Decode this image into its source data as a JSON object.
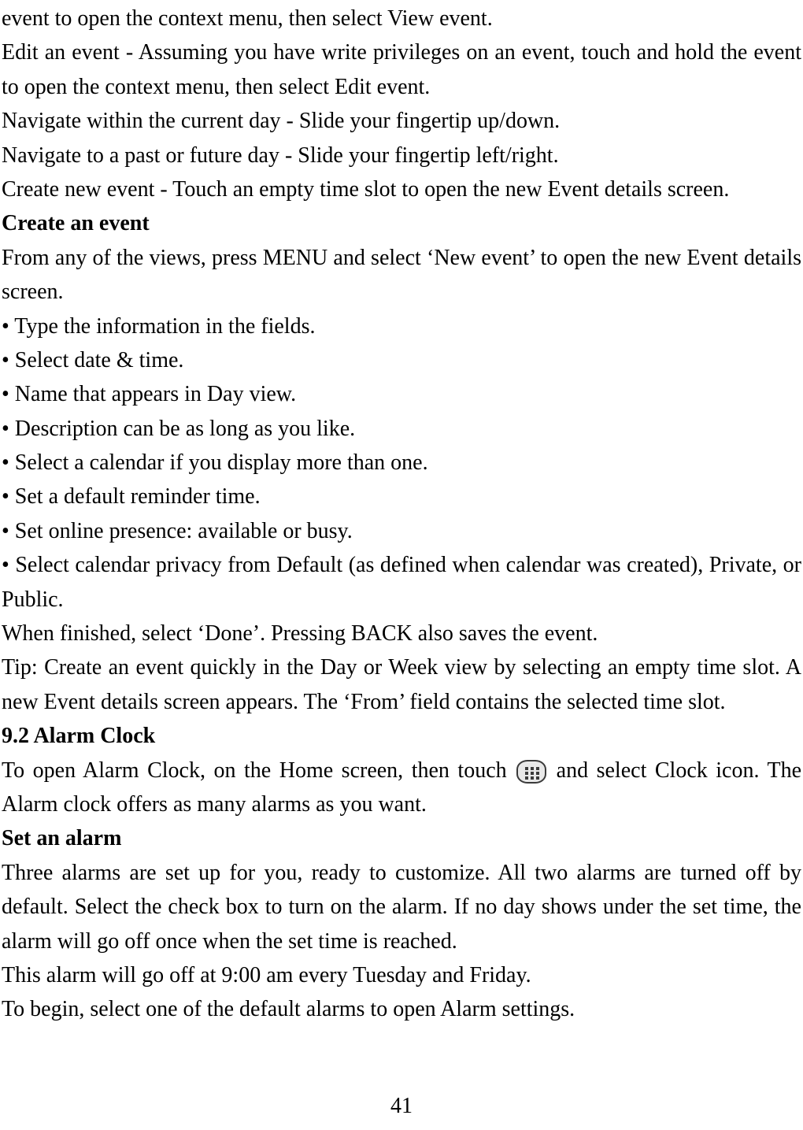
{
  "p1": "event to open the context menu, then select View event.",
  "p2": "Edit an event - Assuming you have write privileges on an event, touch and hold the event to open the context menu, then select Edit event.",
  "p3": "Navigate within the current day - Slide your fingertip up/down.",
  "p4": "Navigate to a past or future day - Slide your fingertip left/right.",
  "p5": "Create new event - Touch an empty time slot to open the new Event details screen.",
  "h1": "Create an event",
  "p6": "From any of the views, press MENU and select ‘New event’ to open the new Event details screen.",
  "b1": "• Type the information in the fields.",
  "b2": "• Select date & time.",
  "b3": "• Name that appears in Day view.",
  "b4": "• Description can be as long as you like.",
  "b5": "• Select a calendar if you display more than one.",
  "b6": "• Set a default reminder time.",
  "b7": "• Set online presence: available or busy.",
  "b8": "• Select calendar privacy from Default (as defined when calendar was created), Private, or Public.",
  "p7": "When finished, select ‘Done’. Pressing BACK also saves the event.",
  "p8": "Tip: Create an event quickly in the Day or Week view by selecting an empty time slot. A new Event details screen appears. The ‘From’ field contains the selected time slot.",
  "h2": "9.2 Alarm Clock",
  "p9a": "To open Alarm Clock, on the Home screen, then touch ",
  "p9b": " and select Clock icon. The Alarm clock offers as many alarms as you want.",
  "h3": "Set an alarm",
  "p10": "Three alarms are set up for you, ready to customize. All two alarms are turned off by default. Select the check box to turn on the alarm. If no day shows under the set time, the alarm will go off once when the set time is reached.",
  "p11": "This alarm will go off at 9:00 am every Tuesday and Friday.",
  "p12": "To begin, select one of the default alarms to open Alarm settings.",
  "pageNum": "41"
}
